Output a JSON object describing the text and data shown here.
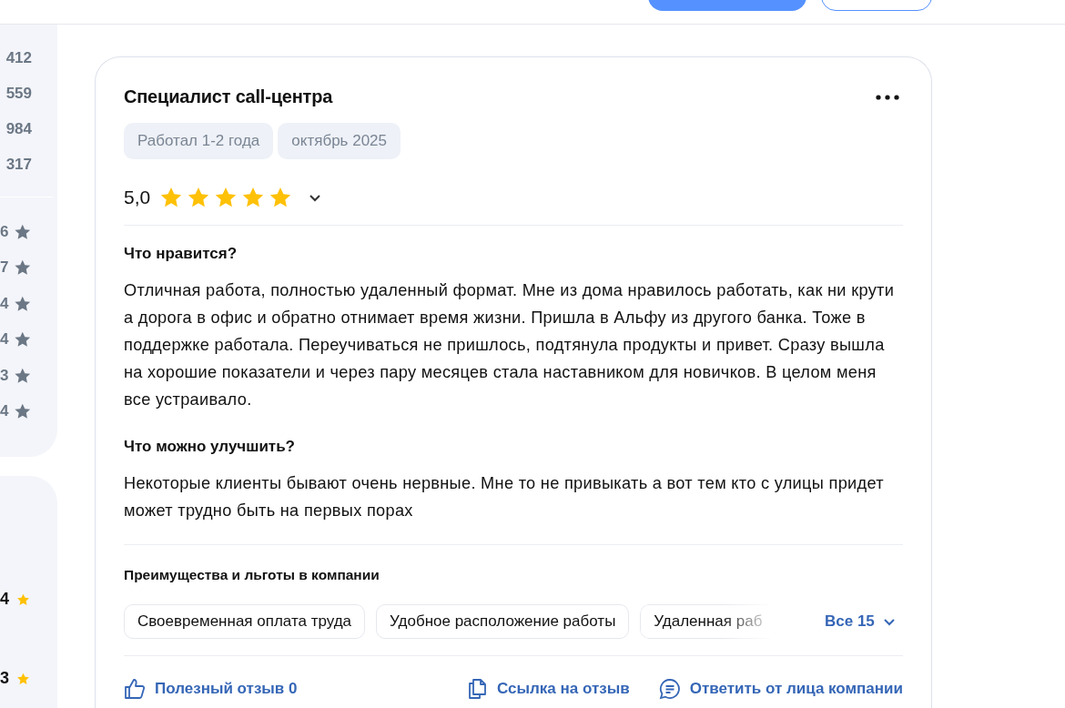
{
  "top_bar": {
    "buttons": [
      {
        "kind": "primary"
      },
      {
        "kind": "outline"
      }
    ]
  },
  "sidebar": {
    "counts": [
      "412",
      "559",
      "984",
      "317"
    ],
    "rating_counts": [
      "6",
      "7",
      "4",
      "4",
      "3",
      "4"
    ],
    "ratings": [
      "4",
      "3"
    ]
  },
  "review": {
    "title": "Специалист call-центра",
    "tags": [
      "Работал 1-2 года",
      "октябрь 2025"
    ],
    "rating": "5,0",
    "stars": 5,
    "sections": [
      {
        "heading": "Что нравится?",
        "text": "Отличная работа, полностью удаленный формат. Мне из дома нравилось работать, как ни крути а дорога в офис и обратно отнимает время жизни. Пришла в Альфу из другого банка. Тоже в поддержке работала. Переучиваться не пришлось, подтянула продукты и привет. Сразу вышла на хорошие показатели и через пару месяцев стала наставником для новичков. В целом меня все устраивало."
      },
      {
        "heading": "Что можно улучшить?",
        "text": "Некоторые клиенты бывают очень нервные. Мне то не привыкать а вот тем кто с улицы придет может трудно быть на первых порах"
      }
    ],
    "benefits": {
      "heading": "Преимущества и льготы в компании",
      "items": [
        "Своевременная оплата труда",
        "Удобное расположение работы",
        "Удаленная раб"
      ],
      "more": "Все 15"
    },
    "actions": [
      {
        "kind": "like",
        "label": "Полезный отзыв 0"
      },
      {
        "kind": "link",
        "label": "Ссылка на отзыв"
      },
      {
        "kind": "reply",
        "label": "Ответить от лица компании"
      }
    ]
  }
}
